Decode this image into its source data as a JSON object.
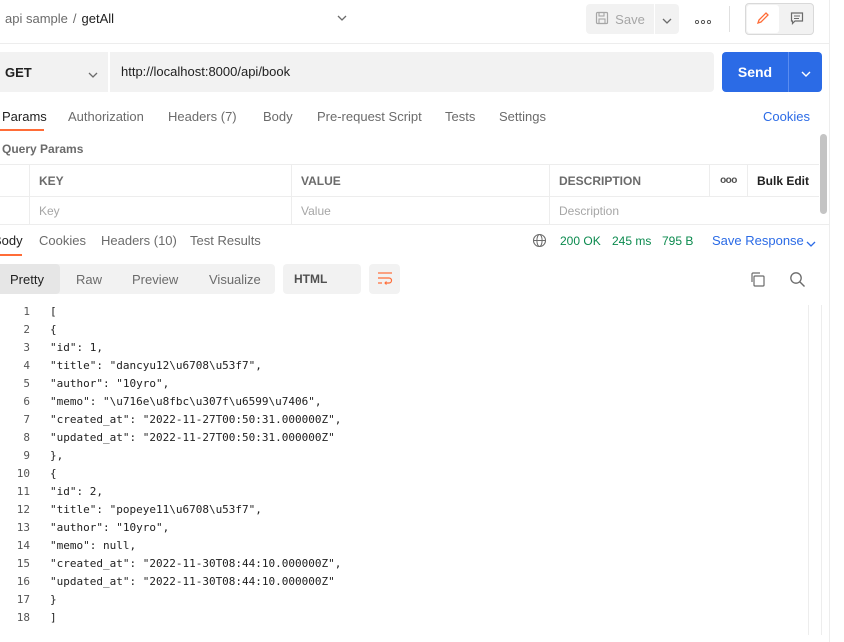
{
  "header": {
    "breadcrumb_parent": "api sample",
    "breadcrumb_sep": "/",
    "breadcrumb_current": "getAll",
    "save_label": "Save"
  },
  "request": {
    "method": "GET",
    "url": "http://localhost:8000/api/book",
    "send_label": "Send"
  },
  "request_tabs": [
    {
      "label": "Params"
    },
    {
      "label": "Authorization"
    },
    {
      "label": "Headers (7)"
    },
    {
      "label": "Body"
    },
    {
      "label": "Pre-request Script"
    },
    {
      "label": "Tests"
    },
    {
      "label": "Settings"
    }
  ],
  "cookies_label": "Cookies",
  "query_params": {
    "label": "Query Params",
    "columns": [
      "KEY",
      "VALUE",
      "DESCRIPTION"
    ],
    "more_label": "ooo",
    "bulk_edit_label": "Bulk Edit",
    "placeholders": [
      "Key",
      "Value",
      "Description"
    ]
  },
  "response_tabs": [
    {
      "label": "Body"
    },
    {
      "label": "Cookies"
    },
    {
      "label": "Headers (10)"
    },
    {
      "label": "Test Results"
    }
  ],
  "response_status": {
    "status": "200 OK",
    "time": "245 ms",
    "size": "795 B",
    "save_response_label": "Save Response"
  },
  "viewer": {
    "tabs": [
      "Pretty",
      "Raw",
      "Preview",
      "Visualize"
    ],
    "format": "HTML"
  },
  "code_lines": [
    {
      "n": "1",
      "t": "["
    },
    {
      "n": "2",
      "t": "{"
    },
    {
      "n": "3",
      "t": "\"id\": 1,"
    },
    {
      "n": "4",
      "t": "\"title\": \"dancyu12\\u6708\\u53f7\","
    },
    {
      "n": "5",
      "t": "\"author\": \"10yro\","
    },
    {
      "n": "6",
      "t": "\"memo\": \"\\u716e\\u8fbc\\u307f\\u6599\\u7406\","
    },
    {
      "n": "7",
      "t": "\"created_at\": \"2022-11-27T00:50:31.000000Z\","
    },
    {
      "n": "8",
      "t": "\"updated_at\": \"2022-11-27T00:50:31.000000Z\""
    },
    {
      "n": "9",
      "t": "},"
    },
    {
      "n": "10",
      "t": "{"
    },
    {
      "n": "11",
      "t": "\"id\": 2,"
    },
    {
      "n": "12",
      "t": "\"title\": \"popeye11\\u6708\\u53f7\","
    },
    {
      "n": "13",
      "t": "\"author\": \"10yro\","
    },
    {
      "n": "14",
      "t": "\"memo\": null,"
    },
    {
      "n": "15",
      "t": "\"created_at\": \"2022-11-30T08:44:10.000000Z\","
    },
    {
      "n": "16",
      "t": "\"updated_at\": \"2022-11-30T08:44:10.000000Z\""
    },
    {
      "n": "17",
      "t": "}"
    },
    {
      "n": "18",
      "t": "]"
    }
  ],
  "colors": {
    "accent_blue": "#2b6be6",
    "tab_underline": "#ff6c37",
    "status_green": "#0b8a4e"
  }
}
